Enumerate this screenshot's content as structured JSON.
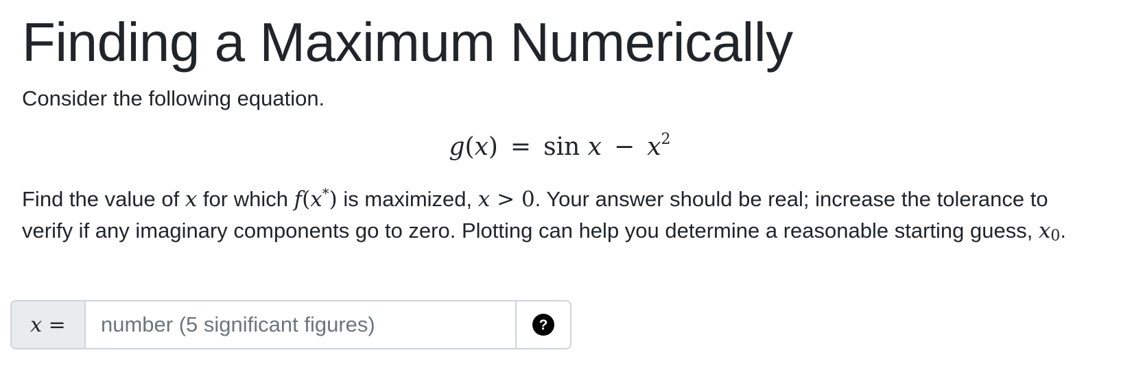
{
  "question": {
    "title": "Finding a Maximum Numerically",
    "intro": "Consider the following equation.",
    "equation": {
      "lhs_func": "g",
      "lhs_var": "x",
      "equals": "=",
      "sin": "sin",
      "var": "x",
      "minus": "−",
      "var2": "x",
      "exp": "2"
    },
    "body": {
      "text_1": "Find the value of ",
      "math_x": "x",
      "text_2": " for which ",
      "math_f": "f",
      "math_xstar": "x",
      "math_star": "*",
      "text_3": " is maximized, ",
      "math_cond_var": "x",
      "math_cond_op": " > ",
      "math_cond_val": "0",
      "text_4": ". Your answer should be real; increase the tolerance to verify if any imaginary components go to zero. Plotting can help you determine a reasonable starting guess, ",
      "math_x0": "x",
      "math_x0_sub": "0",
      "text_5": "."
    }
  },
  "answer": {
    "label_var": "x",
    "label_eq": "=",
    "placeholder": "number (5 significant figures)",
    "value": "",
    "help_symbol": "?"
  }
}
